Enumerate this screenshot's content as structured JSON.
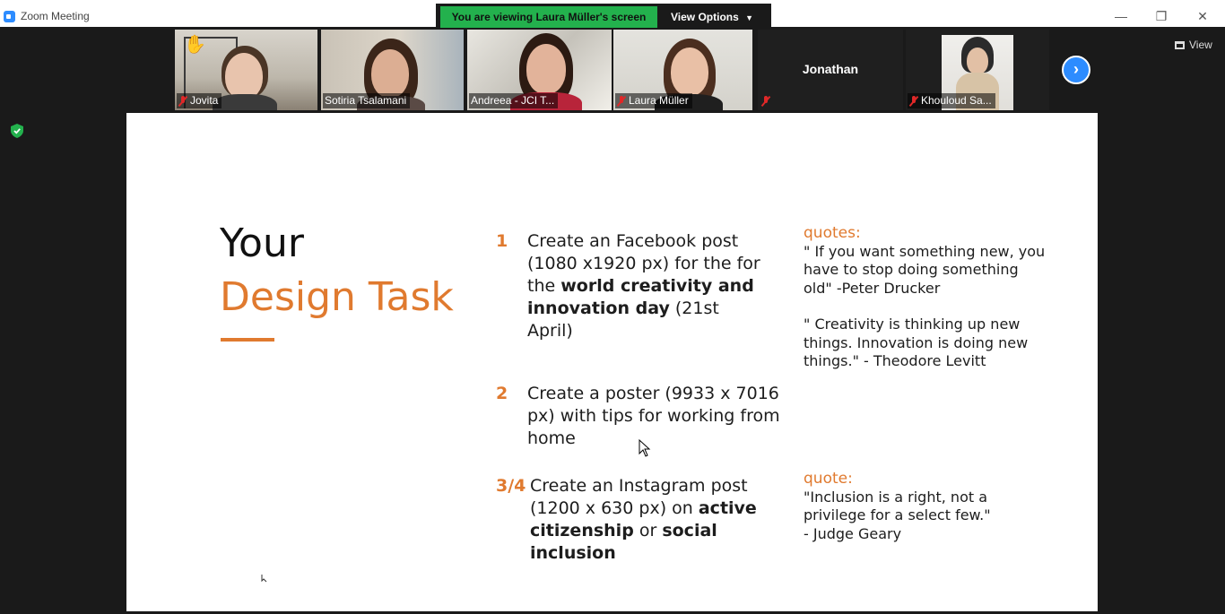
{
  "window": {
    "title": "Zoom Meeting",
    "minimize": "—",
    "restore": "❐",
    "close": "✕"
  },
  "banner": {
    "viewing_text": "You are viewing Laura Müller's screen",
    "view_options_label": "View Options",
    "view_options_icon": "chevron-down-icon",
    "bg_color": "#23b14d"
  },
  "participants": [
    {
      "name": "Jovita",
      "muted": true,
      "hand_raised": true
    },
    {
      "name": "Sotiria Tsalamani",
      "muted": false
    },
    {
      "name": "Andreea - JCI T...",
      "muted": false,
      "active_speaker": true
    },
    {
      "name": "Laura Müller",
      "muted": true
    },
    {
      "name": "Jonathan",
      "muted": true,
      "video_off": true
    },
    {
      "name": "Khouloud Sa...",
      "muted": true
    }
  ],
  "controls": {
    "next_page_icon": "chevron-right-icon",
    "view_label": "View",
    "security_icon": "shield-check-icon"
  },
  "slide": {
    "title_line1": "Your",
    "title_line2": "Design Task",
    "accent_color": "#e07a2f",
    "tasks": [
      {
        "number": "1",
        "text_a": "Create an Facebook post (1080 x1920 px) for the for the ",
        "bold_a": "world creativity and innovation day",
        "text_b": " (21st April)"
      },
      {
        "number": "2",
        "text_a": "Create a poster (9933 x 7016 px) with tips for working from home"
      },
      {
        "number": "3/4",
        "text_a": "Create an Instagram post (1200 x 630 px) on ",
        "bold_a": "active citizenship",
        "text_b": " or ",
        "bold_b": "social inclusion"
      }
    ],
    "quotes_top": {
      "heading": "quotes:",
      "q1": "\" If you want something new, you have to stop doing something old\" -Peter Drucker",
      "q2": "\" Creativity is thinking up new things. Innovation is doing new things.\" - Theodore Levitt"
    },
    "quote_bottom": {
      "heading": "quote:",
      "q1": "\"Inclusion is a right, not a privilege for a select few.\"",
      "author": "- Judge Geary"
    }
  }
}
